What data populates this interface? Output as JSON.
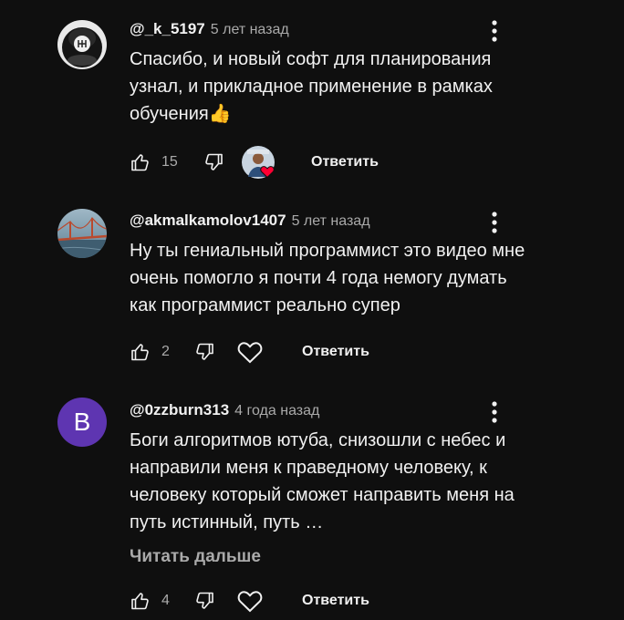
{
  "comments": [
    {
      "author": "@_k_5197",
      "time": "5 лет назад",
      "text": "Спасибо, и новый софт для планирования узнал, и прикладное применение в рамках обучения👍",
      "likes": "15",
      "reply_label": "Ответить",
      "avatar_icon": "gear-shift-knob-avatar",
      "creator_heart": true
    },
    {
      "author": "@akmalkamolov1407",
      "time": "5 лет назад",
      "text": "Ну ты гениальный программист это видео мне очень помогло я почти 4 года немогу думать как программист реально супер",
      "likes": "2",
      "reply_label": "Ответить",
      "avatar_icon": "bridge-photo-avatar"
    },
    {
      "author": "@0zzburn313",
      "time": "4 года назад",
      "text": "Боги алгоритмов ютуба, снизошли с небес и направили меня к праведному человеку, к человеку который сможет направить меня на путь истинный, путь …",
      "read_more": "Читать дальше",
      "likes": "4",
      "reply_label": "Ответить",
      "avatar_letter": "B",
      "avatar_color": "#5e35b1"
    }
  ],
  "colors": {
    "background": "#0f0f0f",
    "text_primary": "#f1f1f1",
    "text_secondary": "#aaaaaa",
    "heart": "#ff0033"
  }
}
